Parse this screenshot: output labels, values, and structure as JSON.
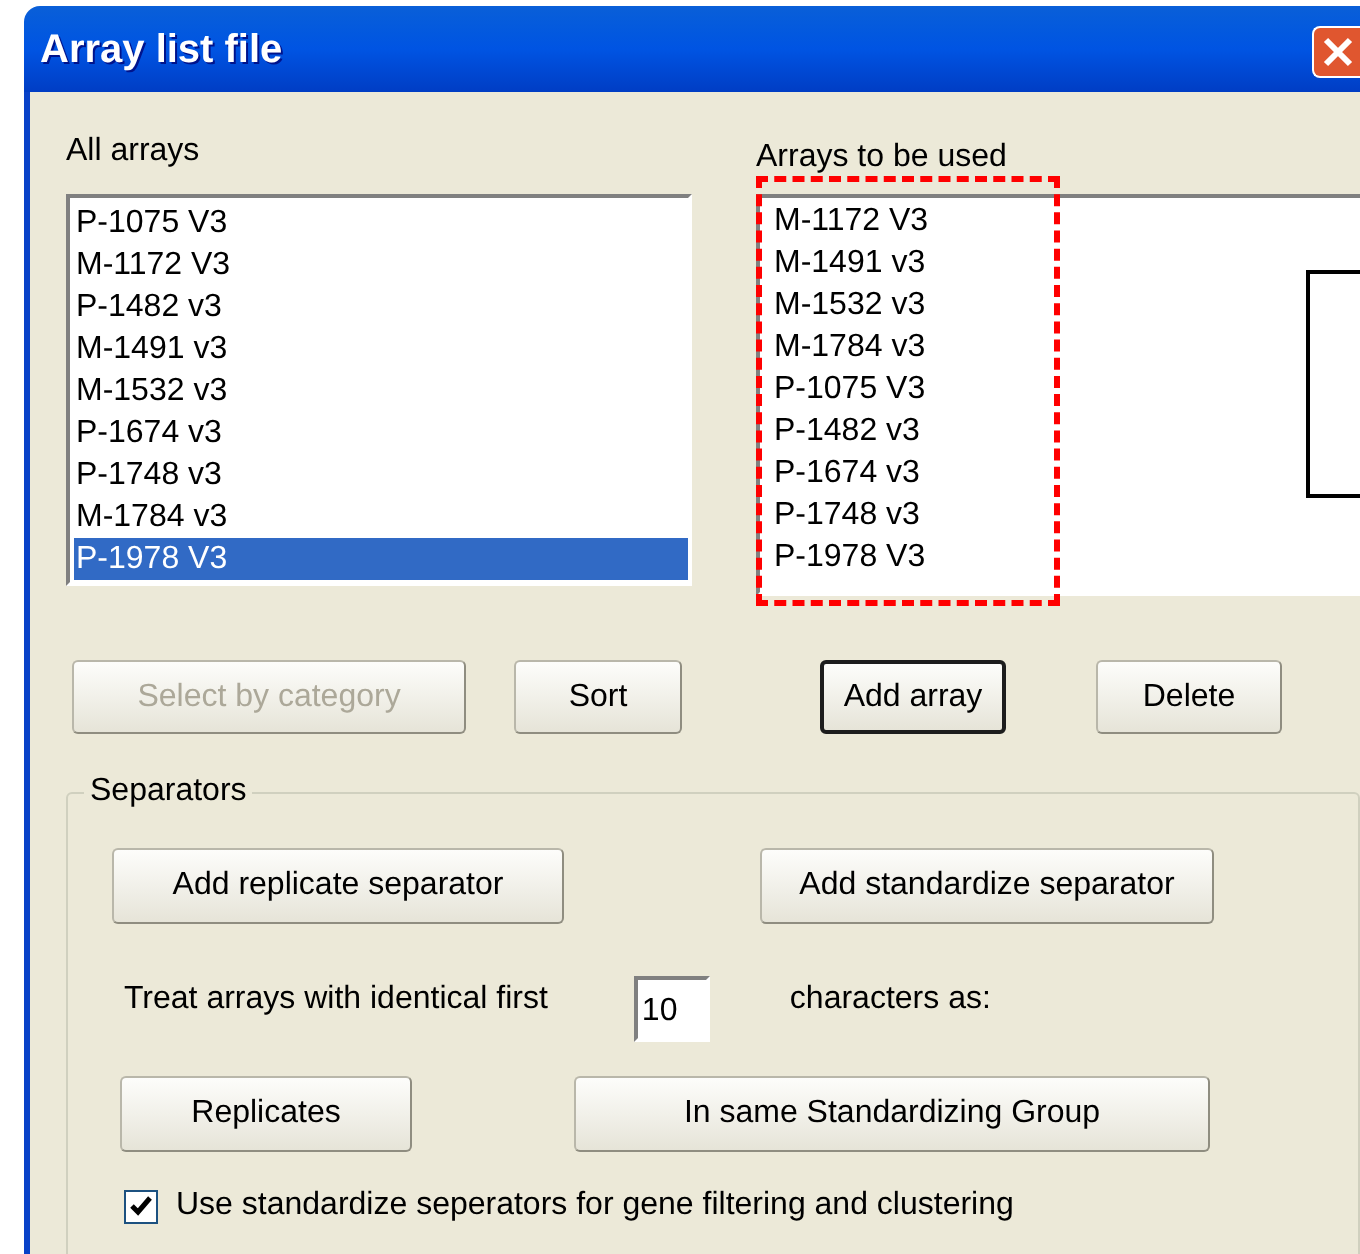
{
  "window": {
    "title": "Array list file"
  },
  "all_arrays": {
    "label": "All arrays",
    "items": [
      {
        "text": "P-1075 V3",
        "selected": false
      },
      {
        "text": "M-1172 V3",
        "selected": false
      },
      {
        "text": "P-1482 v3",
        "selected": false
      },
      {
        "text": "M-1491 v3",
        "selected": false
      },
      {
        "text": "M-1532 v3",
        "selected": false
      },
      {
        "text": "P-1674 v3",
        "selected": false
      },
      {
        "text": "P-1748 v3",
        "selected": false
      },
      {
        "text": "M-1784 v3",
        "selected": false
      },
      {
        "text": "P-1978 V3",
        "selected": true
      }
    ]
  },
  "arrays_to_be_used": {
    "label": "Arrays to be used",
    "items": [
      {
        "text": "M-1172 V3",
        "selected": false
      },
      {
        "text": "M-1491 v3",
        "selected": false
      },
      {
        "text": "M-1532 v3",
        "selected": false
      },
      {
        "text": "M-1784 v3",
        "selected": false
      },
      {
        "text": "P-1075 V3",
        "selected": false
      },
      {
        "text": "P-1482 v3",
        "selected": false
      },
      {
        "text": "P-1674 v3",
        "selected": false
      },
      {
        "text": "P-1748 v3",
        "selected": false
      },
      {
        "text": "P-1978 V3",
        "selected": false
      }
    ]
  },
  "list_buttons": [
    {
      "label": "Select by category",
      "disabled": true,
      "default": false
    },
    {
      "label": "Sort",
      "disabled": false,
      "default": false
    },
    {
      "label": "Add array",
      "disabled": false,
      "default": true
    },
    {
      "label": "Delete",
      "disabled": false,
      "default": false
    }
  ],
  "separators": {
    "title": "Separators",
    "add_buttons": [
      {
        "label": "Add replicate separator"
      },
      {
        "label": "Add standardize separator"
      }
    ],
    "treat_label": "Treat arrays with identical first",
    "characters_value": "10",
    "characters_label": "characters as:",
    "group_buttons": [
      {
        "label": "Replicates"
      },
      {
        "label": "In same Standardizing Group"
      }
    ],
    "checkbox": {
      "label": "Use standardize seperators for gene filtering and clustering",
      "checked": true
    }
  }
}
